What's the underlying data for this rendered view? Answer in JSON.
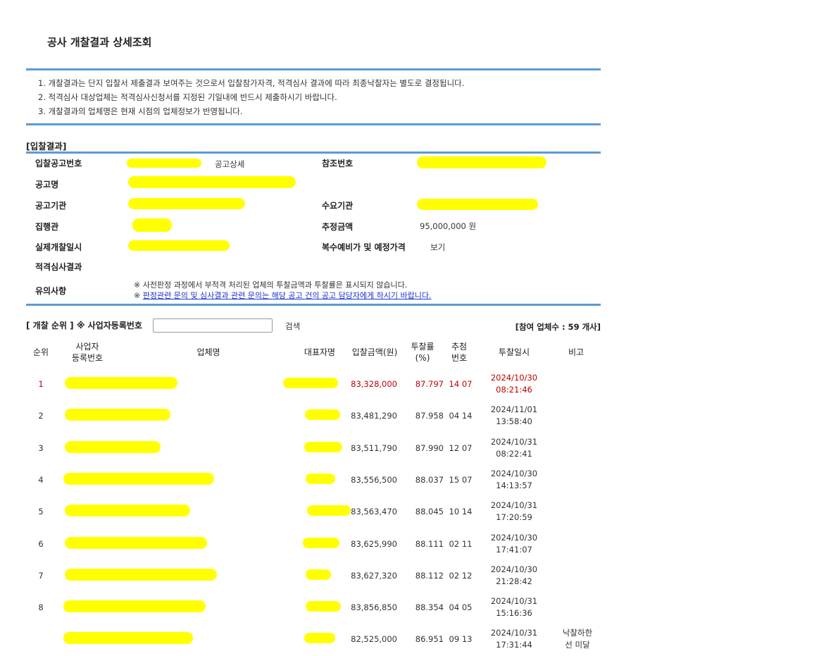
{
  "page_title": "공사 개찰결과 상세조회",
  "notices": [
    "1. 개찰결과는 단지 입찰서 제출결과 보여주는 것으로서 입찰참가자격, 적격심사 결과에 따라 최종낙찰자는 별도로 결정됩니다.",
    "2. 적격심사 대상업체는 적격심사신청서를 지정된 기일내에 반드시 제출하시기 바랍니다.",
    "3. 개찰결과의 업체명은 현재 시점의 업체정보가 반영됩니다."
  ],
  "bid_result": {
    "section_title": "[입찰결과]",
    "labels": {
      "notice_no": "입찰공고번호",
      "ref_no": "참조번호",
      "notice_name": "공고명",
      "agency": "공고기관",
      "demand_agency": "수요기관",
      "executor": "집행관",
      "est_price": "추정금액",
      "open_date": "실제개찰일시",
      "multi_price": "복수예비가 및 예정가격",
      "qual_result": "적격심사결과",
      "caution": "유의사항"
    },
    "notice_detail_link": "공고상세",
    "est_price_value": "95,000,000 원",
    "multi_price_link": "보기",
    "caution_line1": "※ 사전판정 과정에서 부적격 처리된 업체의 투찰금액과 투찰률은 표시되지 않습니다.",
    "caution_line2_prefix": "※ ",
    "caution_line2_link": "판정관련 문의 및 심사결과 관련 문의는 해당 공고 건의 공고 담당자에게 하시기 바랍니다."
  },
  "ranking": {
    "title": "[ 개찰 순위 ]   ※ 사업자등록번호",
    "search_value": "",
    "search_button": "검색",
    "participant_count": "[참여 업체수 : 59 개사]",
    "columns": {
      "rank": "순위",
      "biz_no": "사업자\n등록번호",
      "company": "업체명",
      "rep": "대표자명",
      "bid_amount": "입찰금액(원)",
      "bid_rate": "투찰률\n(%)",
      "draw_no": "추첨\n번호",
      "bid_time": "투찰일시",
      "remark": "비고"
    },
    "rows": [
      {
        "rank": "1",
        "amount": "83,328,000",
        "rate": "87.797",
        "draw": "14 07",
        "date": "2024/10/30",
        "time": "08:21:46",
        "remark": ""
      },
      {
        "rank": "2",
        "amount": "83,481,290",
        "rate": "87.958",
        "draw": "04 14",
        "date": "2024/11/01",
        "time": "13:58:40",
        "remark": ""
      },
      {
        "rank": "3",
        "amount": "83,511,790",
        "rate": "87.990",
        "draw": "12 07",
        "date": "2024/10/31",
        "time": "08:22:41",
        "remark": ""
      },
      {
        "rank": "4",
        "amount": "83,556,500",
        "rate": "88.037",
        "draw": "15 07",
        "date": "2024/10/30",
        "time": "14:13:57",
        "remark": ""
      },
      {
        "rank": "5",
        "amount": "83,563,470",
        "rate": "88.045",
        "draw": "10 14",
        "date": "2024/10/31",
        "time": "17:20:59",
        "remark": ""
      },
      {
        "rank": "6",
        "amount": "83,625,990",
        "rate": "88.111",
        "draw": "02 11",
        "date": "2024/10/30",
        "time": "17:41:07",
        "remark": ""
      },
      {
        "rank": "7",
        "amount": "83,627,320",
        "rate": "88.112",
        "draw": "02 12",
        "date": "2024/10/30",
        "time": "21:28:42",
        "remark": ""
      },
      {
        "rank": "8",
        "amount": "83,856,850",
        "rate": "88.354",
        "draw": "04 05",
        "date": "2024/10/31",
        "time": "15:16:36",
        "remark": ""
      },
      {
        "rank": "",
        "amount": "82,525,000",
        "rate": "86.951",
        "draw": "09 13",
        "date": "2024/10/31",
        "time": "17:31:44",
        "remark": "낙찰하한\n선 미달"
      }
    ]
  },
  "colors": {
    "accent_rule": "#5b9bd5",
    "highlight_red": "#c00000",
    "link_blue": "#1a33cc",
    "redaction": "#ffff00"
  }
}
